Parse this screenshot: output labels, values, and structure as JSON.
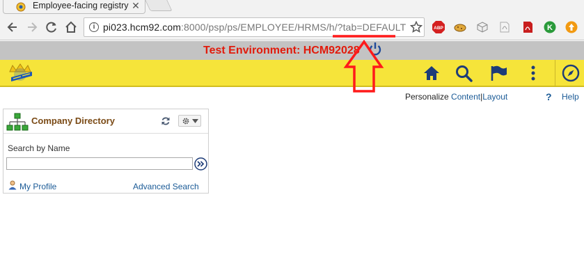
{
  "browser": {
    "tab_title": "Employee-facing registry",
    "url_host": "pi023.hcm92.com",
    "url_path": ":8000/psp/ps/EMPLOYEE/HRMS/h/?tab=DEFAULT",
    "extensions": [
      "abp-icon",
      "cookie-icon",
      "cube-icon",
      "pdf-icon",
      "acrobat-icon",
      "k-icon",
      "up-arrow-icon"
    ]
  },
  "banner": {
    "env_text": "Test Environment: HCM92028"
  },
  "personalize": {
    "prefix": "Personalize",
    "content": "Content",
    "separator": "|",
    "layout": "Layout",
    "help_q": "?",
    "help": "Help"
  },
  "pagelet": {
    "title": "Company Directory",
    "search_label": "Search by Name",
    "search_value": "",
    "my_profile": "My Profile",
    "advanced_search": "Advanced Search"
  },
  "colors": {
    "banner_yellow": "#f6e43a",
    "env_red": "#e11b0c",
    "annotation_red": "#ff1a1a",
    "link_blue": "#1a5a96",
    "nav_icon_blue": "#1e3c78"
  }
}
